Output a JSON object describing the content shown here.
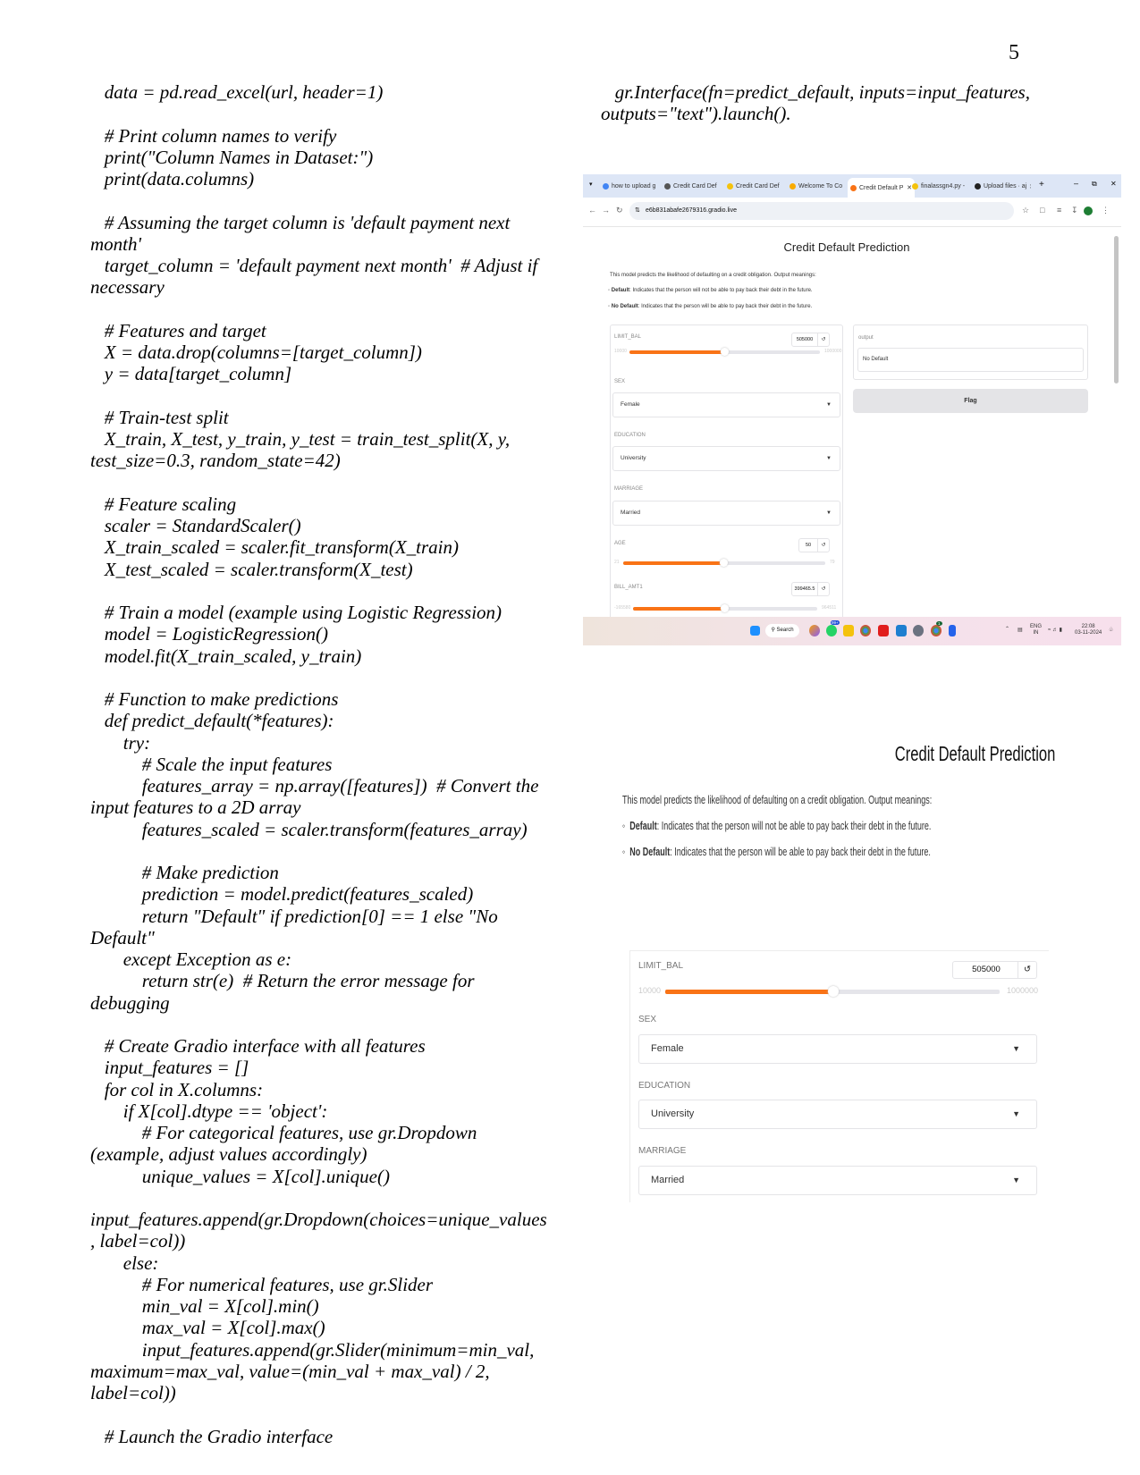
{
  "page_number": "5",
  "left_code": [
    "   data = pd.read_excel(url, header=1)",
    "",
    "   # Print column names to verify",
    "   print(\"Column Names in Dataset:\")",
    "   print(data.columns)",
    "",
    "   # Assuming the target column is 'default payment next",
    "month'",
    "   target_column = 'default payment next month'  # Adjust if",
    "necessary",
    "",
    "   # Features and target",
    "   X = data.drop(columns=[target_column])",
    "   y = data[target_column]",
    "",
    "   # Train-test split",
    "   X_train, X_test, y_train, y_test = train_test_split(X, y,",
    "test_size=0.3, random_state=42)",
    "",
    "   # Feature scaling",
    "   scaler = StandardScaler()",
    "   X_train_scaled = scaler.fit_transform(X_train)",
    "   X_test_scaled = scaler.transform(X_test)",
    "",
    "   # Train a model (example using Logistic Regression)",
    "   model = LogisticRegression()",
    "   model.fit(X_train_scaled, y_train)",
    "",
    "   # Function to make predictions",
    "   def predict_default(*features):",
    "       try:",
    "           # Scale the input features",
    "           features_array = np.array([features])  # Convert the",
    "input features to a 2D array",
    "           features_scaled = scaler.transform(features_array)",
    "",
    "           # Make prediction",
    "           prediction = model.predict(features_scaled)",
    "           return \"Default\" if prediction[0] == 1 else \"No",
    "Default\"",
    "       except Exception as e:",
    "           return str(e)  # Return the error message for",
    "debugging",
    "",
    "   # Create Gradio interface with all features",
    "   input_features = []",
    "   for col in X.columns:",
    "       if X[col].dtype == 'object':",
    "           # For categorical features, use gr.Dropdown",
    "(example, adjust values accordingly)",
    "           unique_values = X[col].unique()",
    "",
    "input_features.append(gr.Dropdown(choices=unique_values",
    ", label=col))",
    "       else:",
    "           # For numerical features, use gr.Slider",
    "           min_val = X[col].min()",
    "           max_val = X[col].max()",
    "           input_features.append(gr.Slider(minimum=min_val,",
    "maximum=max_val, value=(min_val + max_val) / 2,",
    "label=col))",
    "",
    "   # Launch the Gradio interface"
  ],
  "right_code": [
    "   gr.Interface(fn=predict_default, inputs=input_features,",
    "outputs=\"text\").launch()."
  ],
  "browser": {
    "tabs": [
      {
        "label": "how to upload g",
        "icon": "google-icon",
        "color": "#4285f4"
      },
      {
        "label": "Credit Card Def",
        "icon": "chatgpt-icon",
        "color": "#555555"
      },
      {
        "label": "Credit Card Def",
        "icon": "kaggle-icon",
        "color": "#f4c20d"
      },
      {
        "label": "Welcome To Co",
        "icon": "colab-icon",
        "color": "#f9ab00"
      },
      {
        "label": "Credit Default P",
        "icon": "gradio-icon",
        "color": "#f97316"
      },
      {
        "label": "finalassgn4.py -",
        "icon": "file-icon",
        "color": "#f4c20d"
      },
      {
        "label": "Upload files · aj",
        "icon": "github-icon",
        "color": "#222222"
      }
    ],
    "address": "e6b831abafe2679316.gradio.live",
    "app": {
      "title": "Credit Default Prediction",
      "description": "This model predicts the likelihood of defaulting on a credit obligation. Output meanings:",
      "bullets": [
        {
          "term": "Default",
          "text": ": Indicates that the person will not be able to pay back their debt in the future."
        },
        {
          "term": "No Default",
          "text": ": Indicates that the person will be able to pay back their debt in the future."
        }
      ],
      "limit_bal": {
        "label": "LIMIT_BAL",
        "value": "505000",
        "min": "10000",
        "max": "1000000"
      },
      "sex": {
        "label": "SEX",
        "value": "Female"
      },
      "education": {
        "label": "EDUCATION",
        "value": "University"
      },
      "marriage": {
        "label": "MARRIAGE",
        "value": "Married"
      },
      "age": {
        "label": "AGE",
        "value": "50",
        "min": "21",
        "max": "79"
      },
      "bill_amt1": {
        "label": "BILL_AMT1",
        "value": "399465.5",
        "min": "-165580",
        "max": "964511"
      },
      "output": {
        "label": "output",
        "value": "No Default"
      },
      "flag_label": "Flag"
    },
    "taskbar": {
      "search": "Search",
      "whatsapp_badge": "99+",
      "chrome_badge": "1",
      "lang1": "ENG",
      "lang2": "IN",
      "time": "22:08",
      "date": "03-11-2024"
    },
    "accent": "#f97316"
  },
  "crop": {
    "title": "Credit Default Prediction",
    "description": "This model predicts the likelihood of defaulting on a credit obligation. Output meanings:",
    "bullets": [
      {
        "term": "Default",
        "text": ": Indicates that the person will not be able to pay back their debt in the future."
      },
      {
        "term": "No Default",
        "text": ": Indicates that the person will be able to pay back their debt in the future."
      }
    ],
    "limit_bal": {
      "label": "LIMIT_BAL",
      "value": "505000",
      "min": "10000",
      "max": "1000000"
    },
    "sex": {
      "label": "SEX",
      "value": "Female"
    },
    "education": {
      "label": "EDUCATION",
      "value": "University"
    },
    "marriage": {
      "label": "MARRIAGE",
      "value": "Married"
    }
  }
}
